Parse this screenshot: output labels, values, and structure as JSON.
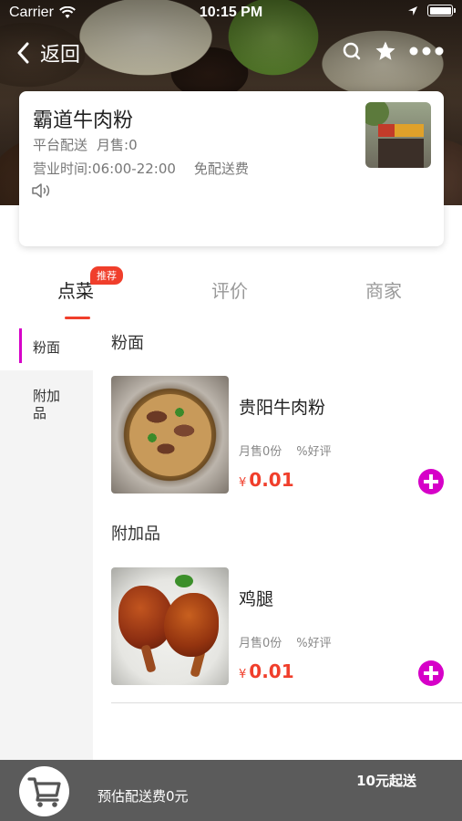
{
  "status_bar": {
    "carrier": "Carrier",
    "time": "10:15 PM"
  },
  "nav": {
    "back_label": "返回"
  },
  "shop": {
    "name": "霸道牛肉粉",
    "delivery_type": "平台配送",
    "monthly_sales": "月售:0",
    "hours": "营业时间:06:00-22:00",
    "delivery_fee": "免配送费"
  },
  "tabs": [
    {
      "label": "点菜",
      "badge": "推荐"
    },
    {
      "label": "评价"
    },
    {
      "label": "商家"
    }
  ],
  "sidebar": {
    "items": [
      {
        "label": "粉面"
      },
      {
        "label": "附加品"
      }
    ]
  },
  "sections": [
    {
      "title": "粉面",
      "dishes": [
        {
          "name": "贵阳牛肉粉",
          "sales": "月售0份",
          "rating": "%好评",
          "currency": "¥",
          "price": "0.01"
        }
      ]
    },
    {
      "title": "附加品",
      "dishes": [
        {
          "name": "鸡腿",
          "sales": "月售0份",
          "rating": "%好评",
          "currency": "¥",
          "price": "0.01"
        }
      ]
    }
  ],
  "cart": {
    "delivery_estimate": "预估配送费0元",
    "min_order": "10元起送"
  },
  "colors": {
    "accent": "#f03e2b",
    "add_button": "#d600c8",
    "cart_bar": "#5b5b5b"
  }
}
